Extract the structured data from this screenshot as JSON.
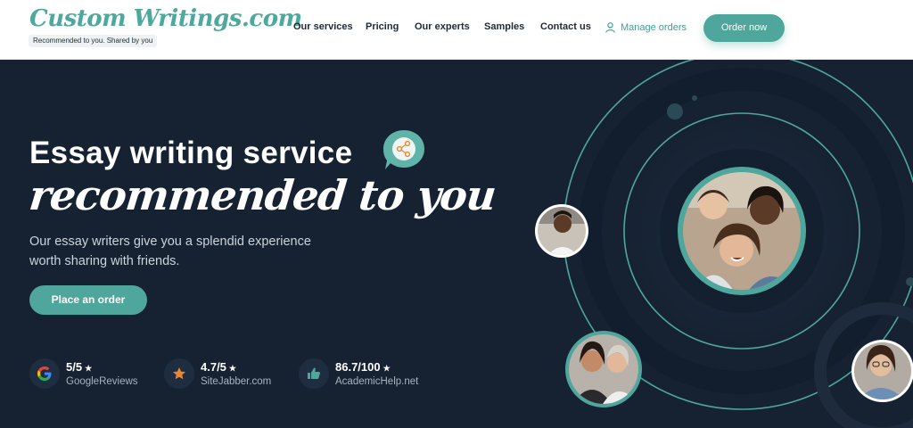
{
  "header": {
    "logo_text": "Custom Writings.com",
    "tagline": "Recommended to you. Shared by you",
    "nav": [
      "Our services",
      "Pricing",
      "Our experts",
      "Samples",
      "Contact us"
    ],
    "manage_orders": "Manage orders",
    "order_now": "Order now"
  },
  "hero": {
    "title": "Essay writing service",
    "title_script": "recommended to you",
    "subtitle": "Our essay writers give you a splendid experience worth sharing with friends.",
    "cta": "Place an order",
    "ratings": [
      {
        "score": "5/5",
        "source": "GoogleReviews",
        "icon": "google-icon"
      },
      {
        "score": "4.7/5",
        "source": "SiteJabber.com",
        "icon": "star-icon"
      },
      {
        "score": "86.7/100",
        "source": "AcademicHelp.net",
        "icon": "thumbs-up-icon"
      }
    ]
  },
  "colors": {
    "accent": "#4ea69c",
    "hero_bg": "#162232",
    "star_orange": "#e8872f"
  }
}
